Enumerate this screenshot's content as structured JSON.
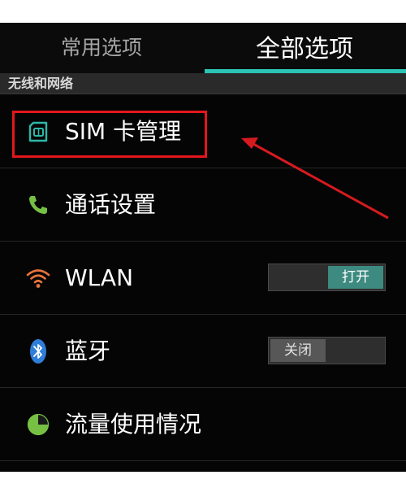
{
  "tabs": {
    "common_label": "常用选项",
    "all_label": "全部选项",
    "active": "all"
  },
  "section": {
    "title": "无线和网络"
  },
  "rows": [
    {
      "label": "SIM 卡管理",
      "icon": "sim-card-icon"
    },
    {
      "label": "通话设置",
      "icon": "phone-icon"
    },
    {
      "label": "WLAN",
      "icon": "wifi-icon",
      "toggle": "打开",
      "toggle_on": true
    },
    {
      "label": "蓝牙",
      "icon": "bluetooth-icon",
      "toggle": "关闭",
      "toggle_on": false
    },
    {
      "label": "流量使用情况",
      "icon": "data-usage-icon"
    }
  ],
  "colors": {
    "accent": "#2cc4b4",
    "highlight": "#e3161d",
    "phone_icon": "#76c043",
    "wifi_icon": "#e8743b",
    "bluetooth_icon": "#2f7ed8"
  }
}
